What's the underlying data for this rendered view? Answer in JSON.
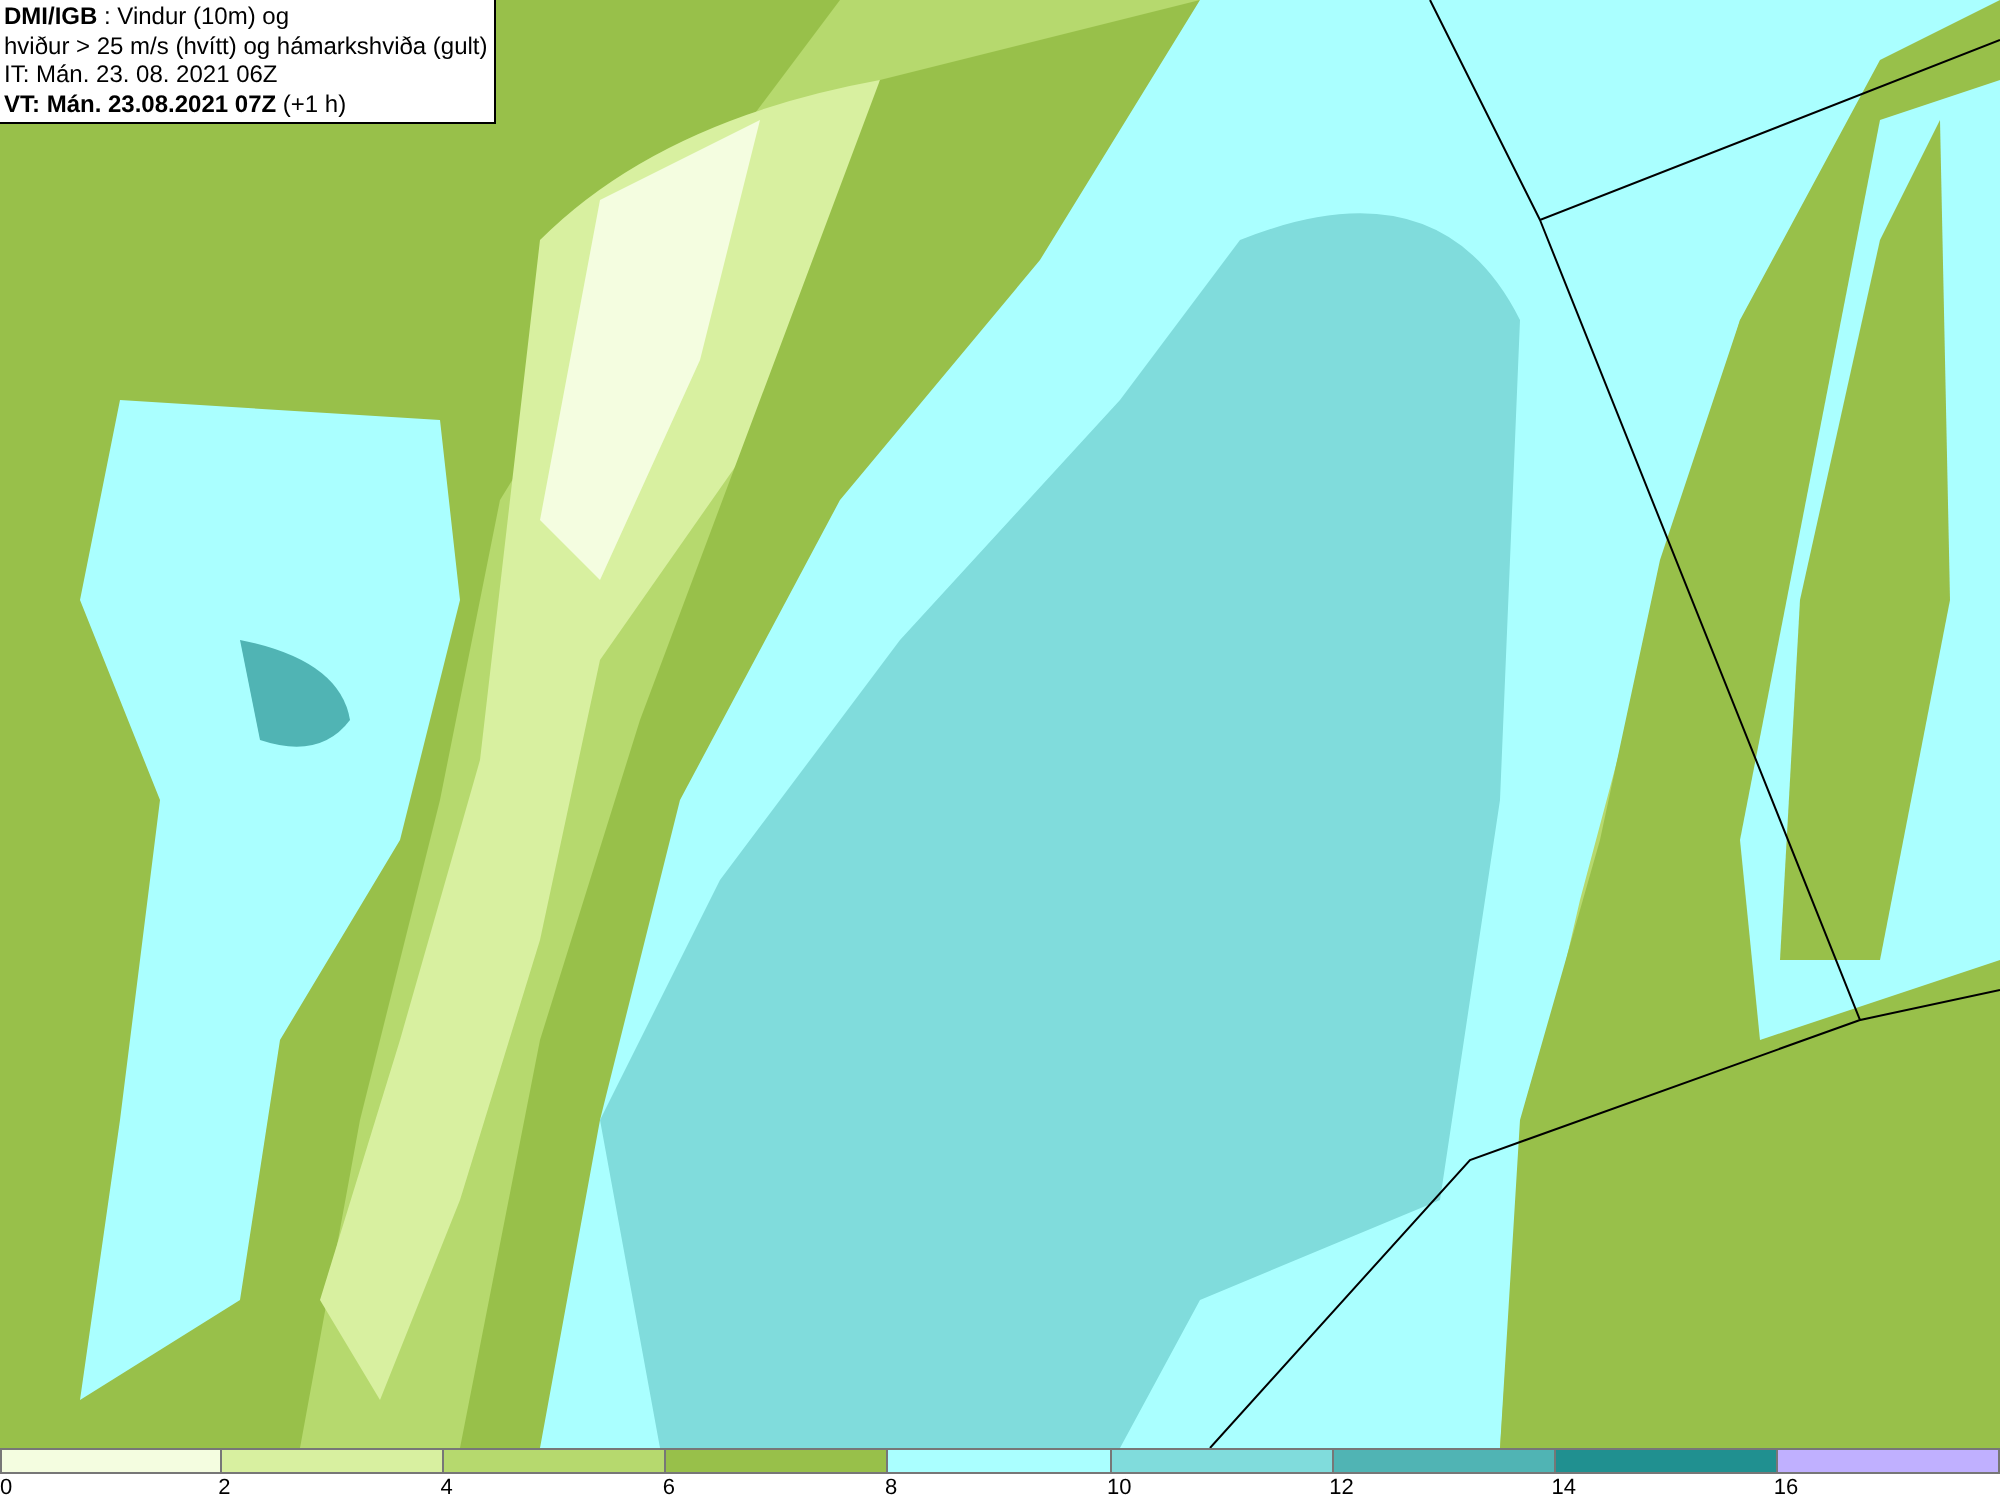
{
  "header": {
    "lines": [
      "**DMI/IGB** : Vindur (10m) og",
      "hviður > 25 m/s (hvítt) og hámarkshviða (gult)",
      "IT: Mán. 23. 08. 2021 06Z",
      "**VT: Mán. 23.08.2021 07Z** (+1 h)"
    ]
  },
  "legend": {
    "bins": [
      {
        "color": "#f4fde0",
        "tick": "0"
      },
      {
        "color": "#d8f0a0",
        "tick": "2"
      },
      {
        "color": "#b6d96e",
        "tick": "4"
      },
      {
        "color": "#98c04a",
        "tick": "6"
      },
      {
        "color": "#aaffff",
        "tick": "8"
      },
      {
        "color": "#80dcdc",
        "tick": "10"
      },
      {
        "color": "#50b4b4",
        "tick": "12"
      },
      {
        "color": "#209090",
        "tick": "14"
      },
      {
        "color": "#c0b0ff",
        "tick": "16"
      }
    ]
  }
}
